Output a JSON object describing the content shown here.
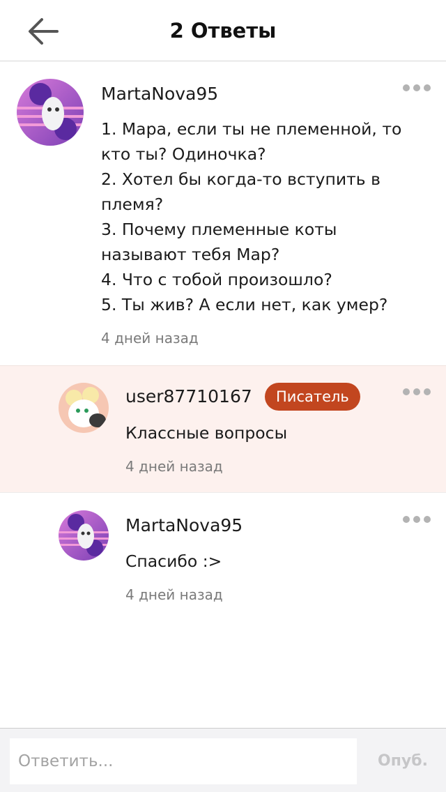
{
  "header": {
    "title": "2 Ответы"
  },
  "comments": [
    {
      "username": "MartaNova95",
      "lines": [
        "1. Мара, если ты не племенной, то",
        "кто ты? Одиночка?",
        "2. Хотел бы когда-то вступить в",
        "племя?",
        "3. Почему племенные коты",
        "называют тебя Мар?",
        "4. Что с тобой произошло?",
        "5. Ты жив? А если нет, как умер?"
      ],
      "timestamp": "4 дней назад"
    },
    {
      "username": "user87710167",
      "badge": "Писатель",
      "text": "Классные вопросы",
      "timestamp": "4 дней назад"
    },
    {
      "username": "MartaNova95",
      "text": "Спасибо :>",
      "timestamp": "4 дней назад"
    }
  ],
  "footer": {
    "placeholder": "Ответить...",
    "publish_label": "Опуб."
  },
  "colors": {
    "badge_bg": "#c2461f",
    "highlight_bg": "#fdf1ee",
    "footer_bg": "#f3f3f5"
  },
  "icons": {
    "back": "back-arrow-icon",
    "more": "more-dots-icon"
  }
}
